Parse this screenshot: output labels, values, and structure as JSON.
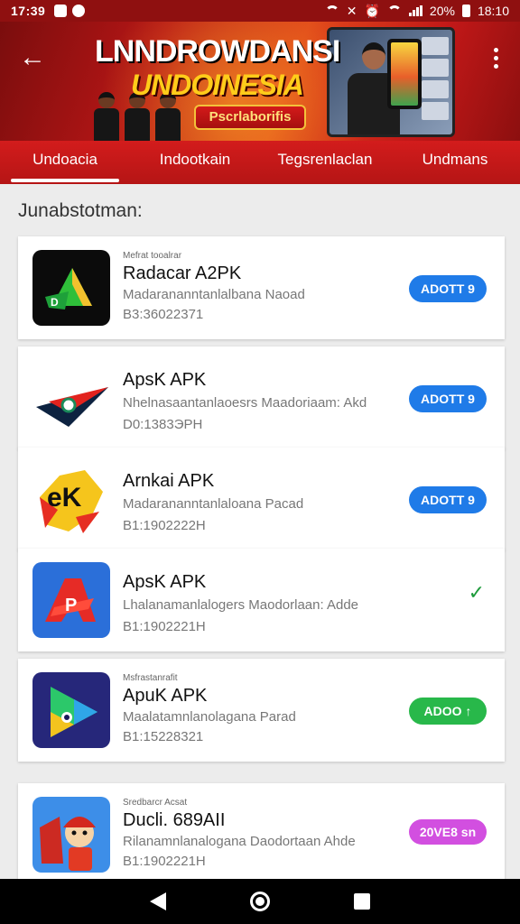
{
  "status_bar": {
    "time": "17:39",
    "battery": "20%",
    "clock_right": "18:10"
  },
  "header": {
    "banner_title": "LNNDROWDANSI",
    "banner_subtitle": "UNDOINESIA",
    "banner_cta": "Pscrlaborifis"
  },
  "tabs": [
    {
      "label": "Undoacia",
      "active": true
    },
    {
      "label": "Indootkain",
      "active": false
    },
    {
      "label": "Tegsrenlaclan",
      "active": false
    },
    {
      "label": "Undmans",
      "active": false
    }
  ],
  "section": {
    "title": "Junabstotman:"
  },
  "apps": [
    {
      "kicker": "Mefrat tooalrar",
      "name": "Radacar A2PK",
      "desc": "Madarananntanlalbana Naoad",
      "version": "B3:36022371",
      "action": "ADOTT 9",
      "action_style": "blue",
      "icon": "green-triangle-icon"
    },
    {
      "kicker": "",
      "name": "ApsK APK",
      "desc": "Nhelnasaantanlaoesrs Maadoriaam: Akd",
      "version": "D0:1383ЭPH",
      "action": "ADOTT 9",
      "action_style": "blue",
      "icon": "red-arrow-icon"
    },
    {
      "kicker": "",
      "name": "Arnkai APK",
      "desc": "Madarananntanlaloana Pacad",
      "version": "B1:1902222H",
      "action": "ADOTT 9",
      "action_style": "blue",
      "icon": "ak-burst-icon"
    },
    {
      "kicker": "",
      "name": "ApsK APK",
      "desc": "Lhalanamanlalogers Maodorlaan: Adde",
      "version": "B1:1902221H",
      "action": "✓",
      "action_style": "check",
      "icon": "red-a-icon"
    },
    {
      "kicker": "Msfrastanrafit",
      "name": "ApuK APK",
      "desc": "Maalatamnlanolagana Parad",
      "version": "B1:15228321",
      "action": "ADOO ↑",
      "action_style": "green",
      "icon": "play-triangle-icon"
    },
    {
      "kicker": "Sredbarcr Acsat",
      "name": "Ducli. 689AII",
      "desc": "Rilanamnlanalogana Daodortaan Ahde",
      "version": "B1:1902221H",
      "action": "20VE8 sn",
      "action_style": "purple",
      "icon": "cartoon-character-icon"
    }
  ],
  "colors": {
    "header_red": "#b71616",
    "button_blue": "#1f7be8",
    "button_green": "#28b84a",
    "button_purple": "#d24fe0"
  }
}
